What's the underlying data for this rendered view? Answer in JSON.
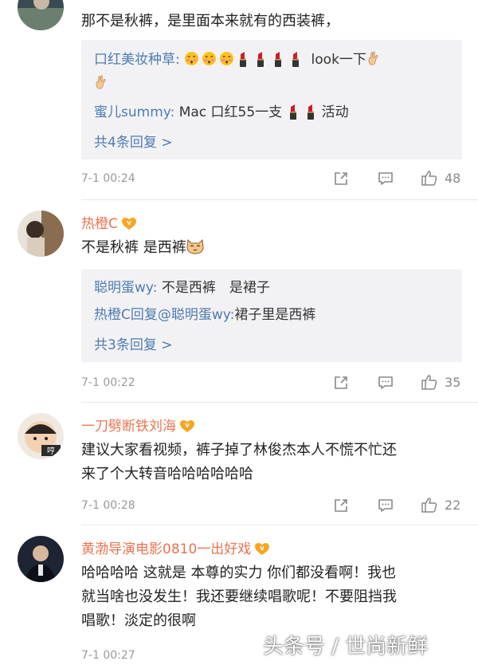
{
  "comments": [
    {
      "text": "那不是秋裤，是里面本来就有的西装裤，",
      "replies": [
        {
          "name": "口红美妆种草:",
          "text": "look一下"
        },
        {
          "name": "蜜儿summy:",
          "text": "Mac 口红55一支",
          "suffix": "活动"
        }
      ],
      "more": "共4条回复 >",
      "time": "7-1 00:24",
      "likes": "48"
    },
    {
      "username": "热橙C",
      "text": "不是秋裤 是西裤",
      "replies": [
        {
          "name": "聪明蛋wy:",
          "text": "不是西裤　是裙子"
        },
        {
          "name": "热橙C回复@聪明蛋wy:",
          "text": "裙子里是西裤"
        }
      ],
      "more": "共3条回复 >",
      "time": "7-1 00:22",
      "likes": "35"
    },
    {
      "username": "一刀劈断铁刘海",
      "avatar_text": "哼",
      "text_lines": [
        "建议大家看视频，裤子掉了林俊杰本人不慌不忙还",
        "来了个大转音哈哈哈哈哈哈"
      ],
      "time": "7-1 00:28",
      "likes": "22"
    },
    {
      "username": "黄渤导演电影0810一出好戏",
      "text_lines": [
        "哈哈哈哈 这就是 本尊的实力 你们都没看啊！我也",
        "就当啥也没发生！我还要继续唱歌呢！不要阻挡我",
        "唱歌！淡定的很啊"
      ],
      "time": "7-1 00:27"
    }
  ],
  "watermark": "头条号 / 世尚新鲜",
  "icons": [
    "share-icon",
    "comment-icon",
    "like-icon",
    "vip-badge-icon",
    "blush-emoji-icon",
    "lipstick-emoji-icon",
    "victory-hand-emoji-icon",
    "cat-emoji-icon"
  ],
  "colors": {
    "username": "#eb7350",
    "reply_name": "#4f7bb0",
    "reply_bg": "#f2f2f5",
    "meta": "#999999"
  }
}
